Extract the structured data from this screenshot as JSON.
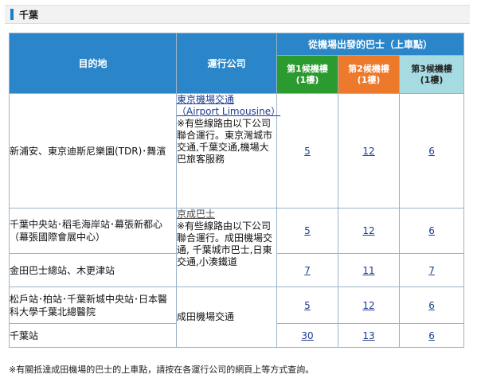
{
  "section": {
    "title": "千葉"
  },
  "header": {
    "destination": "目的地",
    "operator": "運行公司",
    "group": "從機場出發的巴士（上車點）",
    "t1": {
      "name": "第1候機樓",
      "floor": "(1樓)"
    },
    "t2": {
      "name": "第2候機樓",
      "floor": "(1樓)"
    },
    "t3": {
      "name": "第3候機樓",
      "floor": "(1樓)"
    }
  },
  "operators": {
    "op1": {
      "link": "東京機場交通",
      "link_en": "（Airport Limousine）",
      "note": "※有些線路由以下公司聯合運行。東京灣城市交通,千葉交通,機場大巴旅客服務"
    },
    "op2": {
      "link": "京成巴士",
      "note": "※有些線路由以下公司聯合運行。成田機場交通, 千葉城市巴士,日東交通,小湊鐵道"
    },
    "op3": {
      "name": "成田機場交通"
    }
  },
  "rows": [
    {
      "dest": "新浦安、東京迪斯尼樂園(TDR)･舞濱",
      "t1": "5",
      "t2": "12",
      "t3": "6"
    },
    {
      "dest": "千葉中央站･稻毛海岸站･幕張新都心（幕張國際會展中心）",
      "t1": "5",
      "t2": "12",
      "t3": "6"
    },
    {
      "dest": "金田巴士總站、木更津站",
      "t1": "7",
      "t2": "11",
      "t3": "7"
    },
    {
      "dest": "松戶站･柏站･千葉新城中央站･日本醫科大學千葉北總醫院",
      "t1": "5",
      "t2": "12",
      "t3": "6"
    },
    {
      "dest": "千葉站",
      "t1": "30",
      "t2": "13",
      "t3": "6"
    }
  ],
  "footnote": "※有關抵達成田機場的巴士的上車點，請按在各運行公司的網頁上等方式查詢。",
  "colors": {
    "header": "#2a86c8",
    "t1": "#2b9a2f",
    "t2": "#ed7a2a",
    "t3": "#a6dbe2",
    "accent": "#1a7fc4"
  }
}
